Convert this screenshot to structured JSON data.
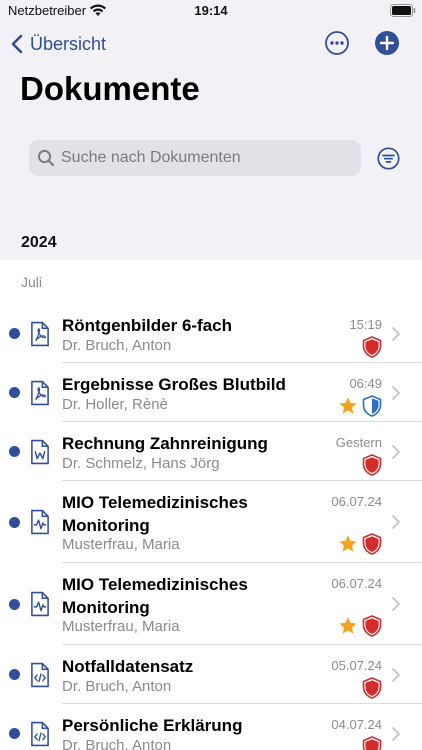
{
  "status_bar": {
    "carrier": "Netzbetreiber",
    "time": "19:14"
  },
  "nav": {
    "back_label": "Übersicht"
  },
  "page": {
    "title": "Dokumente"
  },
  "search": {
    "placeholder": "Suche nach Dokumenten"
  },
  "sections": {
    "year": "2024",
    "month": "Juli"
  },
  "colors": {
    "accent": "#2f4e9c",
    "shield_red": "#d62b2b",
    "shield_blue": "#2c6fc9",
    "star": "#f5a31a"
  },
  "documents": [
    {
      "title": "Röntgenbilder 6-fach",
      "author": "Dr. Bruch, Anton",
      "time": "15:19",
      "file_icon": "pdf-file-icon",
      "starred": false,
      "shield": "red",
      "unread": true
    },
    {
      "title": "Ergebnisse Großes Blutbild",
      "author": "Dr. Holler, Rènè",
      "time": "06:49",
      "file_icon": "pdf-file-icon",
      "starred": true,
      "shield": "blue",
      "unread": true
    },
    {
      "title": "Rechnung Zahnreinigung",
      "author": "Dr. Schmelz, Hans Jörg",
      "time": "Gestern",
      "file_icon": "word-file-icon",
      "starred": false,
      "shield": "red",
      "unread": true
    },
    {
      "title": "MIO Telemedizinisches Monitoring",
      "author": "Musterfrau, Maria",
      "time": "06.07.24",
      "file_icon": "monitoring-file-icon",
      "starred": true,
      "shield": "red",
      "unread": true
    },
    {
      "title": "MIO Telemedizinisches Monitoring",
      "author": "Musterfrau, Maria",
      "time": "06.07.24",
      "file_icon": "monitoring-file-icon",
      "starred": true,
      "shield": "red",
      "unread": true
    },
    {
      "title": "Notfalldatensatz",
      "author": "Dr. Bruch, Anton",
      "time": "05.07.24",
      "file_icon": "code-file-icon",
      "starred": false,
      "shield": "red",
      "unread": true
    },
    {
      "title": "Persönliche Erklärung",
      "author": "Dr. Bruch, Anton",
      "time": "04.07.24",
      "file_icon": "code-file-icon",
      "starred": false,
      "shield": "red",
      "unread": true
    }
  ]
}
